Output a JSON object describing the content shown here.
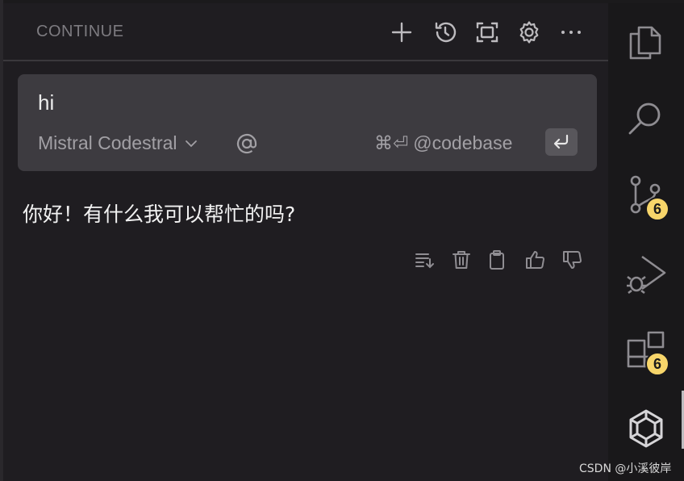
{
  "header": {
    "title": "CONTINUE",
    "actions": [
      "new-session-icon",
      "history-icon",
      "fullscreen-icon",
      "settings-icon",
      "more-icon"
    ]
  },
  "input": {
    "text": "hi",
    "model": "Mistral Codestral",
    "shortcut": "⌘⏎",
    "codebase_label": "@codebase"
  },
  "response": {
    "text": "你好！有什么我可以帮忙的吗?"
  },
  "message_actions": [
    "continue-generation-icon",
    "delete-icon",
    "copy-icon",
    "thumbs-up-icon",
    "thumbs-down-icon"
  ],
  "activity_bar": {
    "items": [
      {
        "name": "explorer-icon"
      },
      {
        "name": "search-icon"
      },
      {
        "name": "source-control-icon",
        "badge": "6"
      },
      {
        "name": "run-debug-icon"
      },
      {
        "name": "extensions-icon",
        "badge": "6"
      },
      {
        "name": "continue-logo-icon"
      }
    ]
  },
  "watermark": "CSDN @小溪彼岸",
  "colors": {
    "badge": "#f7d56a",
    "panel_bg": "#1f1d21",
    "input_bg": "#3d3b40"
  }
}
